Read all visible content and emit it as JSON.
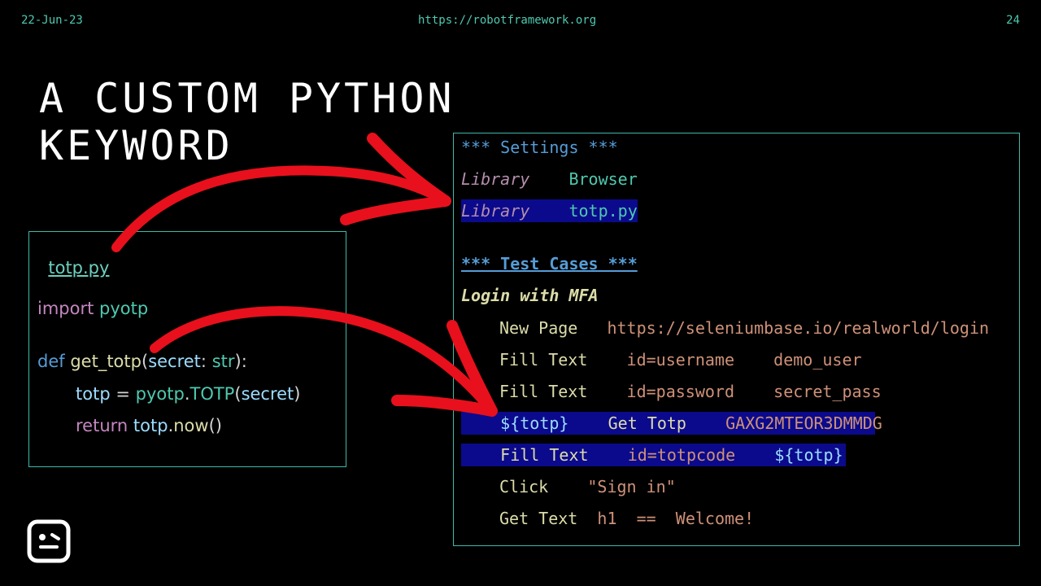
{
  "header": {
    "date": "22-Jun-23",
    "url": "https://robotframework.org",
    "page_number": "24"
  },
  "title": {
    "line1": "A CUSTOM PYTHON",
    "line2": "KEYWORD"
  },
  "python_file": {
    "filename": "totp.py",
    "import_kw": "import",
    "import_mod": "pyotp",
    "def_kw": "def",
    "func_name": "get_totp",
    "param": "secret",
    "param_type": "str",
    "var": "totp",
    "eq": "=",
    "module_ref": "pyotp",
    "class_ref": "TOTP",
    "arg_ref": "secret",
    "return_kw": "return",
    "return_obj": "totp",
    "method": "now"
  },
  "robot_file": {
    "settings_header": "*** Settings ***",
    "settings": [
      {
        "keyword": "Library",
        "value": "Browser"
      },
      {
        "keyword": "Library",
        "value": "totp.py"
      }
    ],
    "test_cases_header": "*** Test Cases ***",
    "test_name": "Login with MFA",
    "steps": {
      "new_page_kw": "New Page",
      "new_page_arg": "https://seleniumbase.io/realworld/login",
      "fill1_kw": "Fill Text",
      "fill1_sel": "id=username",
      "fill1_val": "demo_user",
      "fill2_kw": "Fill Text",
      "fill2_sel": "id=password",
      "fill2_val": "secret_pass",
      "totp_var": "${totp}",
      "get_totp_kw": "Get Totp",
      "secret": "GAXG2MTEOR3DMMDG",
      "fill3_kw": "Fill Text",
      "fill3_sel": "id=totpcode",
      "fill3_val": "${totp}",
      "click_kw": "Click",
      "click_arg": "\"Sign in\"",
      "gettext_kw": "Get Text",
      "gettext_sel": "h1",
      "gettext_op": "==",
      "gettext_val": "Welcome!"
    }
  },
  "colors": {
    "background": "#000000",
    "box_border": "#3fb8a8",
    "highlight": "#0b0a8c",
    "arrow": "#e8101c"
  },
  "icons": [
    "robot-logo-icon",
    "arrow-icon"
  ]
}
